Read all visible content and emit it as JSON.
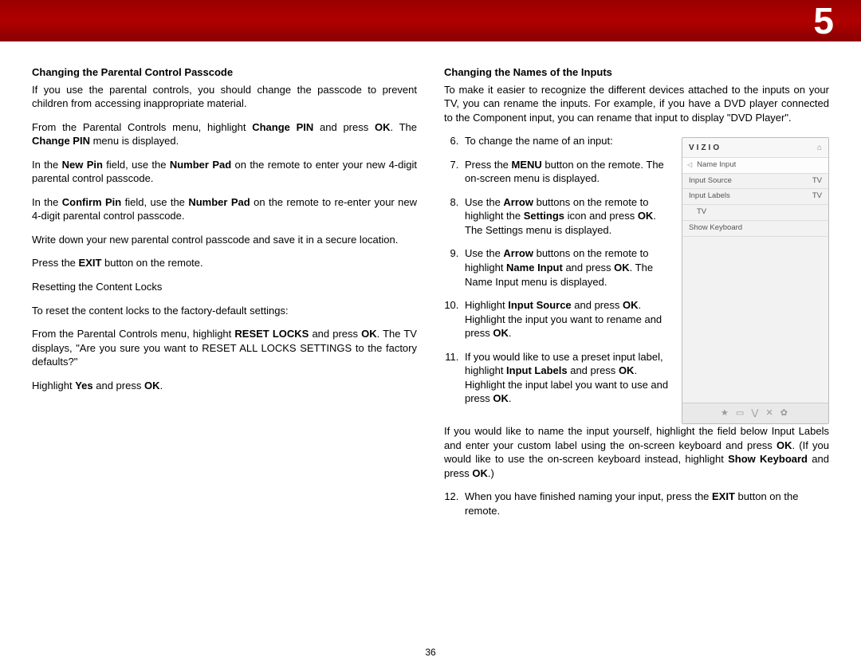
{
  "chapter": "5",
  "page_number": "36",
  "left": {
    "heading": "Changing the Parental Control Passcode",
    "p1": "If you use the parental controls, you should change the passcode to prevent children from accessing inappropriate material.",
    "p2_a": "From the Parental Controls menu, highlight ",
    "p2_b": "Change PIN",
    "p2_c": " and press ",
    "p2_d": "OK",
    "p2_e": ". The ",
    "p2_f": "Change PIN",
    "p2_g": " menu is displayed.",
    "p3_a": "In the ",
    "p3_b": "New Pin",
    "p3_c": " field, use the ",
    "p3_d": "Number Pad",
    "p3_e": " on the remote to enter your new 4-digit parental control passcode.",
    "p4_a": "In the ",
    "p4_b": "Confirm Pin",
    "p4_c": " field, use the ",
    "p4_d": "Number Pad",
    "p4_e": " on the remote to re-enter your new 4-digit parental control passcode.",
    "p5": "Write down your new parental control passcode and save it in a secure location.",
    "p6_a": "Press the ",
    "p6_b": "EXIT",
    "p6_c": " button on the remote.",
    "p7": "Resetting the Content Locks",
    "p8": "To reset the content locks to the factory-default settings:",
    "p9_a": "From the Parental Controls menu, highlight ",
    "p9_b": "RESET LOCKS",
    "p9_c": " and press ",
    "p9_d": "OK",
    "p9_e": ". The TV displays, \"Are you sure you want to RESET ALL LOCKS SETTINGS to the factory defaults?\"",
    "p10_a": "Highlight ",
    "p10_b": "Yes",
    "p10_c": " and press ",
    "p10_d": "OK",
    "p10_e": "."
  },
  "right": {
    "heading": "Changing the Names of the Inputs",
    "intro": "To make it easier to recognize the different devices attached to the inputs on your TV, you can rename the inputs. For example, if you have a DVD player connected to the Component input, you can rename that input to display \"DVD Player\".",
    "li6": "To change the name of an input:",
    "li7_a": "Press the ",
    "li7_b": "MENU",
    "li7_c": " button on the remote. The on-screen menu is displayed.",
    "li8_a": "Use the ",
    "li8_b": "Arrow",
    "li8_c": " buttons on the remote to highlight the ",
    "li8_d": "Settings",
    "li8_e": " icon and press ",
    "li8_f": "OK",
    "li8_g": ". The Settings menu is displayed.",
    "li9_a": "Use the ",
    "li9_b": "Arrow",
    "li9_c": " buttons on the remote to highlight ",
    "li9_d": "Name Input",
    "li9_e": " and press ",
    "li9_f": "OK",
    "li9_g": ". The Name Input menu is displayed.",
    "li10_a": "Highlight ",
    "li10_b": "Input Source",
    "li10_c": " and press ",
    "li10_d": "OK",
    "li10_e": ". Highlight the input you want to rename and press ",
    "li10_f": "OK",
    "li10_g": ".",
    "li11_a": "If you would like to use a preset input label, highlight ",
    "li11_b": "Input Labels",
    "li11_c": " and press ",
    "li11_d": "OK",
    "li11_e": ". Highlight the input label you want to use and press ",
    "li11_f": "OK",
    "li11_g": ".",
    "cont_a": "If you would like to name the input yourself, highlight the field below Input Labels and enter your custom label using the on-screen keyboard and press ",
    "cont_b": "OK",
    "cont_c": ". (If you would like to use the on-screen keyboard instead, highlight ",
    "cont_d": "Show Keyboard",
    "cont_e": " and press ",
    "cont_f": "OK",
    "cont_g": ".)",
    "li12_a": "When you have finished naming your input, press the ",
    "li12_b": "EXIT",
    "li12_c": " button on the remote."
  },
  "osd": {
    "brand": "VIZIO",
    "crumb": "Name Input",
    "rows": [
      {
        "label": "Input Source",
        "value": "TV"
      },
      {
        "label": "Input Labels",
        "value": "TV"
      },
      {
        "label": "TV",
        "value": ""
      },
      {
        "label": "Show Keyboard",
        "value": ""
      }
    ],
    "foot": "★  ▭  ⋁  ✕  ✿"
  }
}
